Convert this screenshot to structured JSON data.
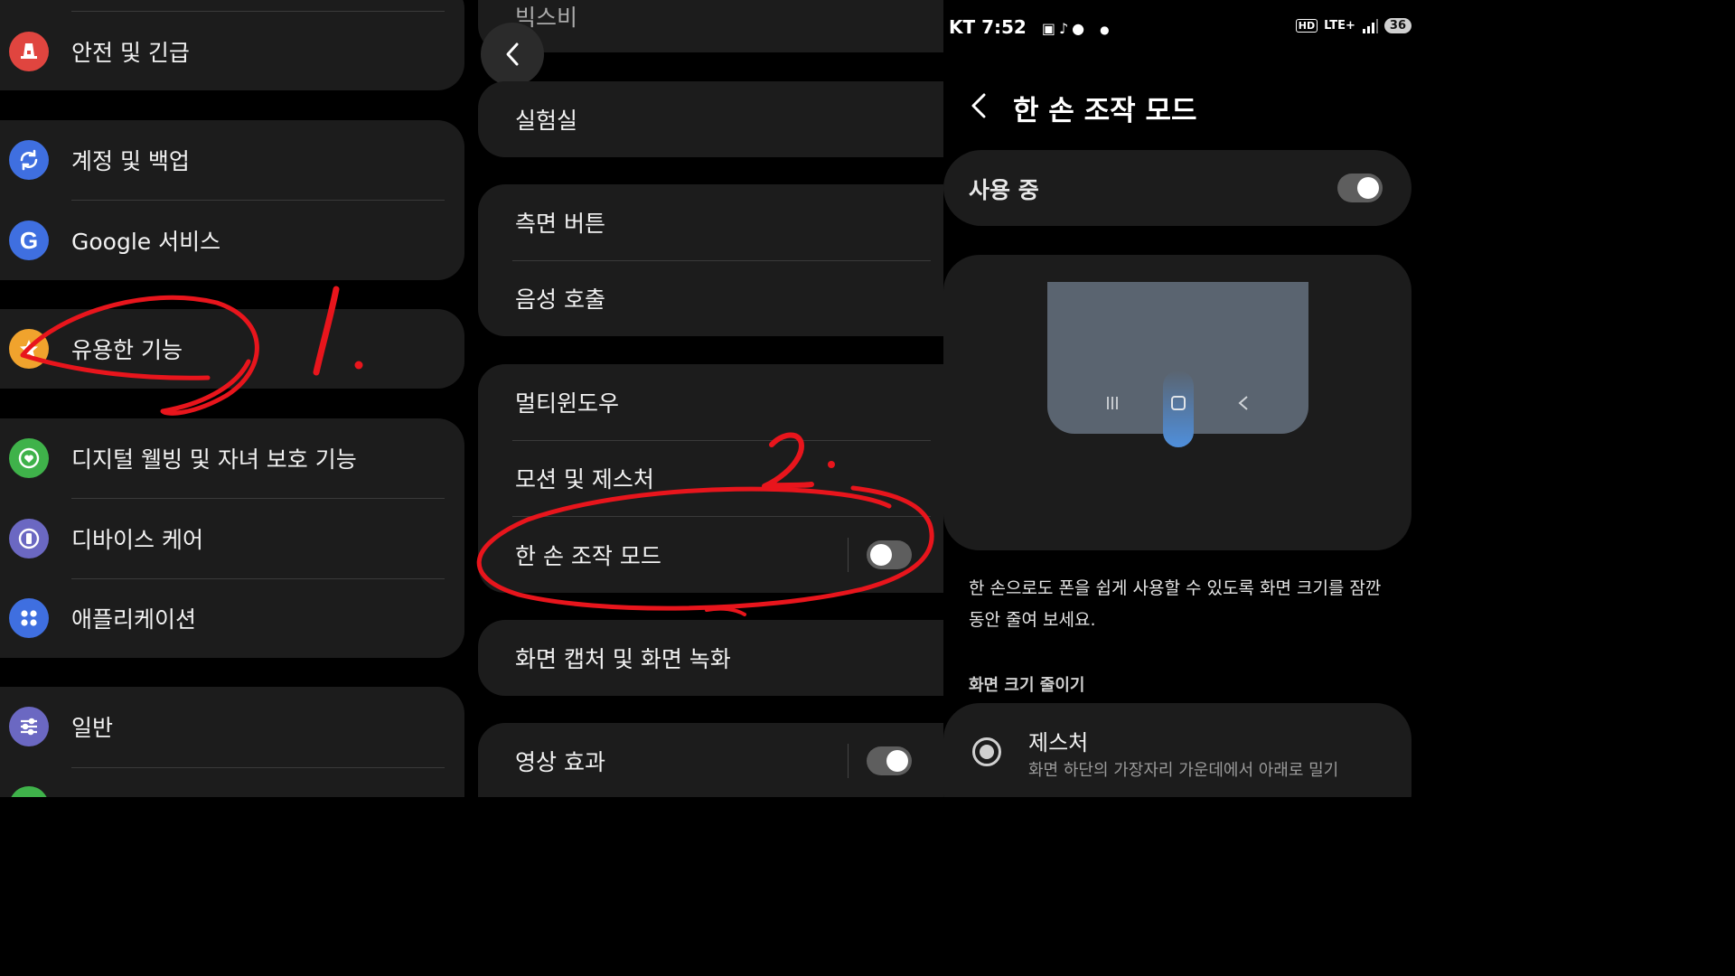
{
  "left_menu": {
    "items": [
      {
        "label": "안전 및 긴급",
        "icon": "safety-icon",
        "color": "#e0453f"
      },
      {
        "label": "계정 및 백업",
        "icon": "sync-icon",
        "color": "#3f6fe0"
      },
      {
        "label": "Google 서비스",
        "icon": "google-icon",
        "color": "#3f6fe0"
      },
      {
        "label": "유용한 기능",
        "icon": "star-icon",
        "color": "#f0a32d"
      },
      {
        "label": "디지털 웰빙 및 자녀 보호 기능",
        "icon": "wellbeing-icon",
        "color": "#3fb24a"
      },
      {
        "label": "디바이스 케어",
        "icon": "device-care-icon",
        "color": "#6b68c2"
      },
      {
        "label": "애플리케이션",
        "icon": "apps-icon",
        "color": "#3f6fe0"
      },
      {
        "label": "일반",
        "icon": "sliders-icon",
        "color": "#6b68c2"
      }
    ]
  },
  "middle_menu": {
    "items": [
      {
        "label": "빅스비"
      },
      {
        "label": "실험실"
      },
      {
        "label": "측면 버튼"
      },
      {
        "label": "음성 호출"
      },
      {
        "label": "멀티윈도우"
      },
      {
        "label": "모션 및 제스처"
      },
      {
        "label": "한 손 조작 모드",
        "toggle": "off"
      },
      {
        "label": "화면 캡처 및 화면 녹화"
      },
      {
        "label": "영상 효과",
        "toggle": "off"
      }
    ]
  },
  "annotations": {
    "step1": "1.",
    "step2": "2.",
    "color": "#e8151c"
  },
  "status_bar": {
    "carrier_time": "KT 7:52",
    "hd": "HD",
    "network": "LTE+",
    "battery": "36"
  },
  "one_hand_mode": {
    "title": "한 손 조작 모드",
    "master_toggle_label": "사용 중",
    "master_toggle": "off",
    "description": "한 손으로도 폰을 쉽게 사용할 수 있도록 화면 크기를 잠깐동안 줄여 보세요.",
    "section_header": "화면 크기 줄이기",
    "option_title": "제스처",
    "option_subtitle": "화면 하단의 가장자리 가운데에서 아래로 밀기"
  },
  "colors": {
    "card": "#1c1c1c",
    "accent_blue": "#4f8fdc",
    "preview_screen": "#5a6470"
  }
}
